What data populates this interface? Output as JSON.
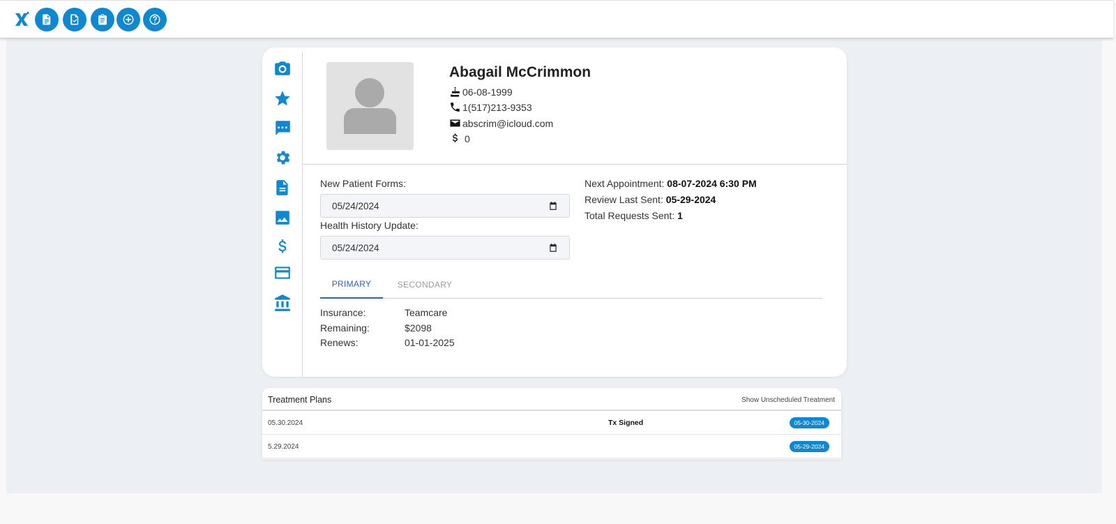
{
  "toolbar": {
    "logo_icon": "brand-x-logo",
    "buttons": [
      {
        "icon": "document-icon"
      },
      {
        "icon": "document-check-icon"
      },
      {
        "icon": "clipboard-icon"
      },
      {
        "icon": "plus-circle-icon"
      },
      {
        "icon": "help-icon"
      }
    ]
  },
  "side_nav": [
    "camera-icon",
    "star-icon",
    "chat-icon",
    "gear-icon",
    "document-icon",
    "image-icon",
    "dollar-icon",
    "credit-card-icon",
    "bank-icon"
  ],
  "patient": {
    "name": "Abagail McCrimmon",
    "birthdate": "06-08-1999",
    "phone": "1(517)213-9353",
    "email": "abscrim@icloud.com",
    "balance": "0"
  },
  "forms": {
    "new_patient_label": "New Patient Forms:",
    "new_patient_value": "05/24/2024",
    "health_history_label": "Health History Update:",
    "health_history_value": "05/24/2024"
  },
  "appointments": {
    "next_label": "Next Appointment:",
    "next_value": "08-07-2024 6:30 PM",
    "review_label": "Review Last Sent:",
    "review_value": "05-29-2024",
    "requests_label": "Total Requests Sent:",
    "requests_value": "1"
  },
  "insurance_tabs": {
    "primary": "PRIMARY",
    "secondary": "SECONDARY",
    "active": "PRIMARY"
  },
  "insurance": {
    "insurance_label": "Insurance:",
    "insurance_value": "Teamcare",
    "remaining_label": "Remaining:",
    "remaining_value": "$2098",
    "renews_label": "Renews:",
    "renews_value": "01-01-2025"
  },
  "treatment_plans": {
    "title": "Treatment Plans",
    "toggle_label": "Show Unscheduled Treatment",
    "rows": [
      {
        "date": "05.30.2024",
        "status": "Tx Signed",
        "badge": "05-30-2024"
      },
      {
        "date": "5.29.2024",
        "status": "",
        "badge": "05-29-2024"
      }
    ]
  },
  "colors": {
    "accent": "#0f88d3",
    "tab_active": "#2f5fbf",
    "page_bg": "#eceff4"
  }
}
